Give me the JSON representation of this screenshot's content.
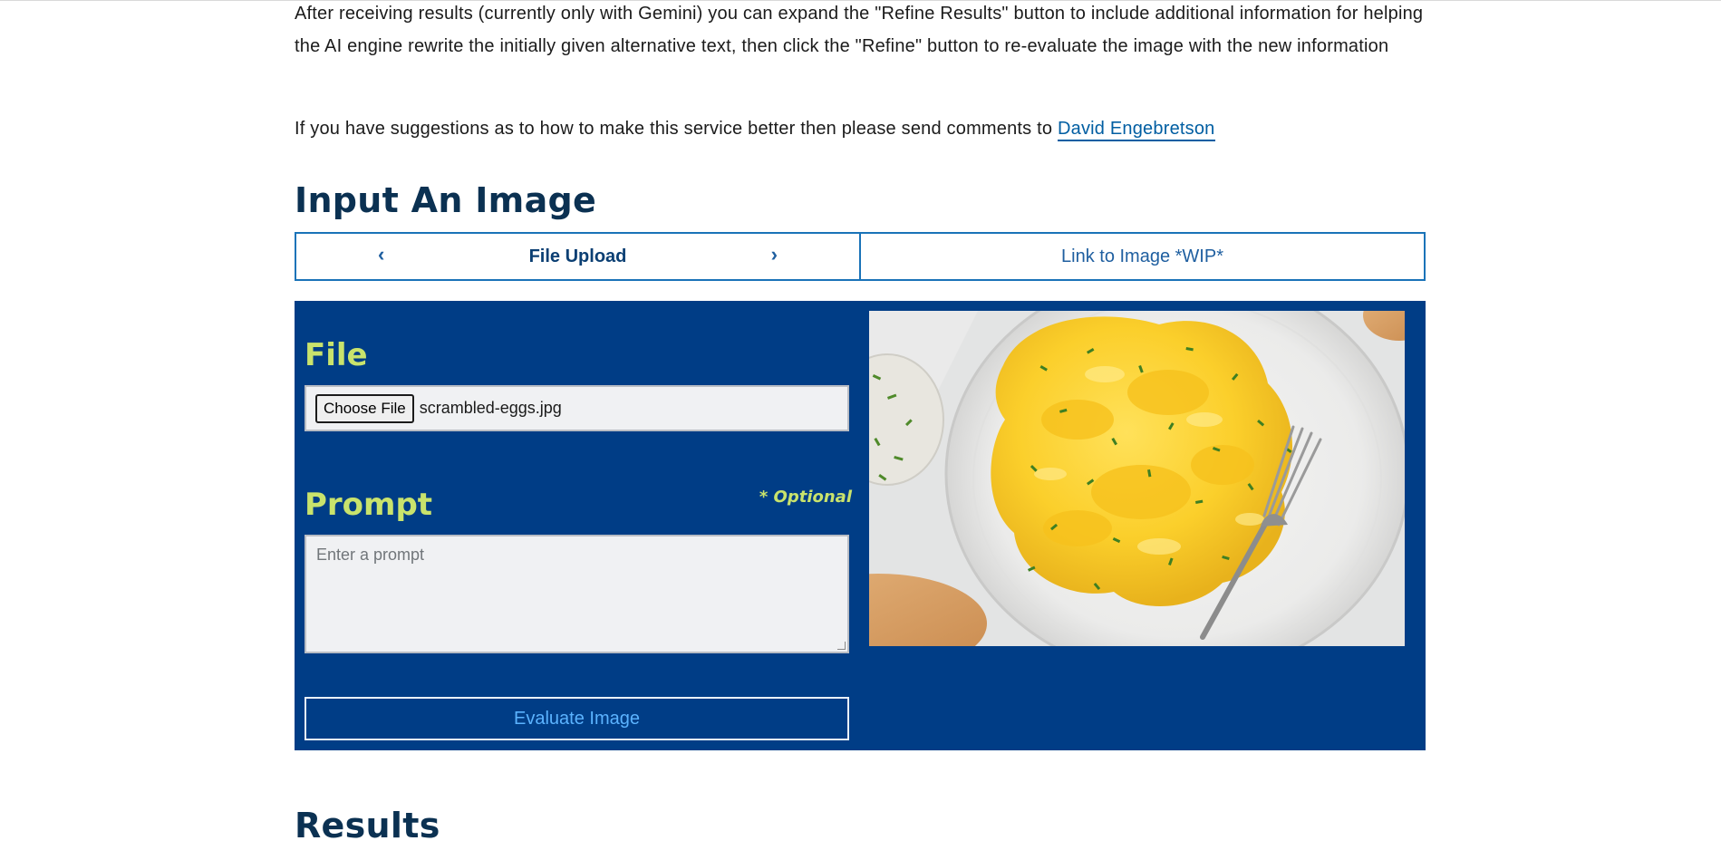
{
  "intro": {
    "paragraph1": "After receiving results (currently only with Gemini) you can expand the \"Refine Results\" button to include additional information for helping the AI engine rewrite the initially given alternative text, then click the \"Refine\" button to re-evaluate the image with the new information",
    "paragraph2_prefix": "If you have suggestions as to how to make this service better then please send comments to ",
    "contact_name": "David Engebretson"
  },
  "input_section": {
    "title": "Input An Image",
    "tabs": [
      {
        "label": "File Upload",
        "active": true
      },
      {
        "label": "Link to Image *WIP*",
        "active": false
      }
    ]
  },
  "form": {
    "file_label": "File",
    "choose_file_label": "Choose File",
    "file_name": "scrambled-eggs.jpg",
    "prompt_label": "Prompt",
    "optional_note": "* Optional",
    "prompt_placeholder": "Enter a prompt",
    "prompt_value": "",
    "evaluate_label": "Evaluate Image"
  },
  "results_section": {
    "title": "Results"
  },
  "colors": {
    "panel_bg": "#003d86",
    "label_accent": "#c9e36c",
    "heading": "#0b3152",
    "link": "#005ea2",
    "tab_border": "#1a73b8"
  },
  "icons": [
    "chevron-left-icon",
    "chevron-right-icon"
  ]
}
